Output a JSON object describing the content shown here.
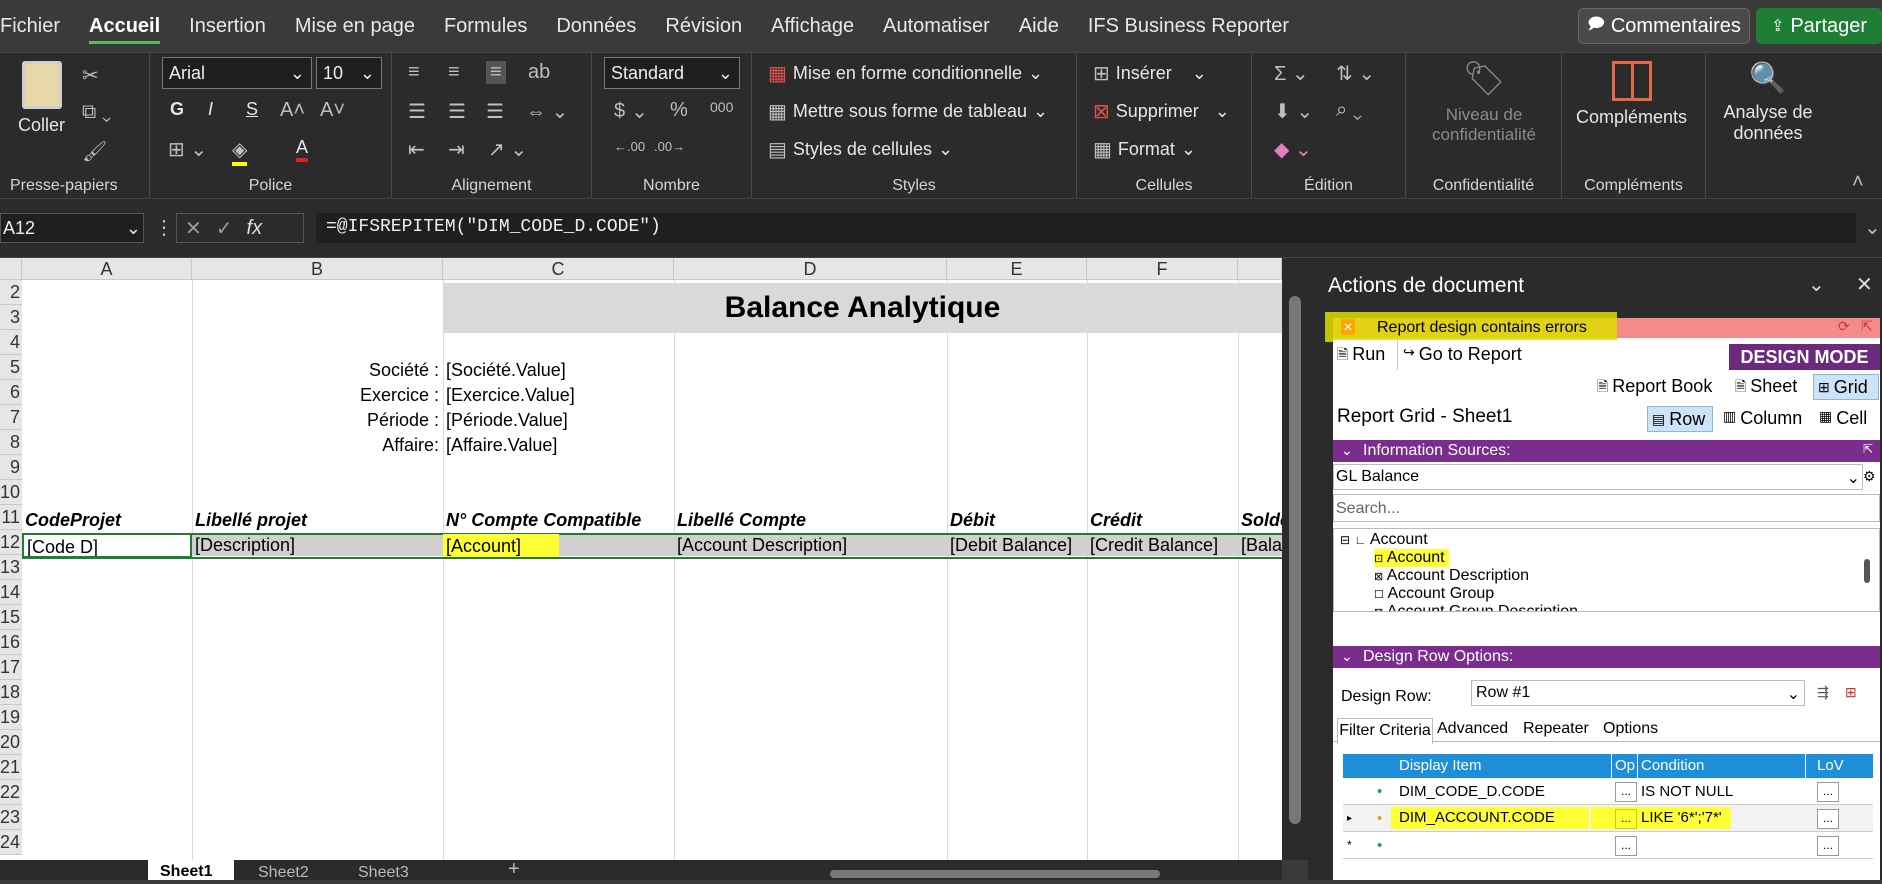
{
  "menu": {
    "items": [
      "Fichier",
      "Accueil",
      "Insertion",
      "Mise en page",
      "Formules",
      "Données",
      "Révision",
      "Affichage",
      "Automatiser",
      "Aide",
      "IFS Business Reporter"
    ],
    "comments_label": "Commentaires",
    "share_label": "Partager"
  },
  "ribbon": {
    "paste_label": "Coller",
    "clipboard_label": "Presse-papiers",
    "font_name": "Arial",
    "font_size": "10",
    "bold": "G",
    "italic": "I",
    "underline": "S",
    "police_label": "Police",
    "alignment_label": "Alignement",
    "number_format": "Standard",
    "number_label": "Nombre",
    "currency_symbol": "$",
    "percent_symbol": "%",
    "thousands_symbol": "000",
    "cond_format_label": "Mise en forme conditionnelle",
    "table_format_label": "Mettre sous forme de tableau",
    "cell_styles_label": "Styles de cellules",
    "styles_label": "Styles",
    "insert_label": "Insérer",
    "delete_label": "Supprimer",
    "format_label": "Format",
    "cells_label": "Cellules",
    "edition_label": "Édition",
    "sensitivity_label": "Niveau de confidentialité",
    "confidentiality_label": "Confidentialité",
    "addins_label": "Compléments",
    "addins_group_label": "Compléments",
    "data_analysis_label": "Analyse de données"
  },
  "formula_bar": {
    "name_box": "A12",
    "fx": "fx",
    "formula": "=@IFSREPITEM(\"DIM_CODE_D.CODE\")"
  },
  "sheet": {
    "columns": [
      "A",
      "B",
      "C",
      "D",
      "E",
      "F"
    ],
    "row_numbers": [
      "2",
      "3",
      "4",
      "5",
      "6",
      "7",
      "8",
      "9",
      "10",
      "11",
      "12",
      "13",
      "14",
      "15",
      "16",
      "17",
      "18",
      "19",
      "20",
      "21",
      "22",
      "23",
      "24"
    ],
    "title": "Balance Analytique",
    "labels": [
      {
        "label": "Société :",
        "value": "[Société.Value]"
      },
      {
        "label": "Exercice :",
        "value": "[Exercice.Value]"
      },
      {
        "label": "Période :",
        "value": "[Période.Value]"
      },
      {
        "label": "Affaire:",
        "value": "[Affaire.Value]"
      }
    ],
    "headers": [
      "CodeProjet",
      "Libellé projet",
      "N° Compte Compatible",
      "Libellé Compte",
      "Débit",
      "Crédit",
      "Solde"
    ],
    "data_row": [
      "[Code D]",
      "[Description]",
      "[Account]",
      "[Account Description]",
      "[Debit Balance]",
      "[Credit Balance]",
      "[Balance]"
    ],
    "tabs": [
      "Sheet1",
      "Sheet2",
      "Sheet3"
    ]
  },
  "panel": {
    "title": "Actions de document",
    "error_text": "Report design contains errors",
    "run_label": "Run",
    "goto_label": "Go to Report",
    "mode_label": "DESIGN MODE",
    "report_book_label": "Report Book",
    "sheet_label": "Sheet",
    "grid_label": "Grid",
    "grid_title": "Report Grid - Sheet1",
    "row_label": "Row",
    "column_label": "Column",
    "cell_label": "Cell",
    "info_sources_label": "Information Sources:",
    "source_value": "GL Balance",
    "search_placeholder": "Search...",
    "tree": [
      "Account",
      "Account",
      "Account Description",
      "Account Group",
      "Account Group Description"
    ],
    "design_row_options_label": "Design Row Options:",
    "design_row_label": "Design Row:",
    "design_row_value": "Row #1",
    "tabs": [
      "Filter Criteria",
      "Advanced",
      "Repeater",
      "Options"
    ],
    "grid_headers": [
      "Display Item",
      "Op",
      "Condition",
      "LoV"
    ],
    "grid_rows": [
      {
        "item": "DIM_CODE_D.CODE",
        "op": "...",
        "condition": "IS NOT NULL",
        "lov": "..."
      },
      {
        "item": "DIM_ACCOUNT.CODE",
        "op": "...",
        "condition": "LIKE '6*';'7*'",
        "lov": "..."
      },
      {
        "item": "",
        "op": "...",
        "condition": "",
        "lov": "..."
      }
    ]
  }
}
